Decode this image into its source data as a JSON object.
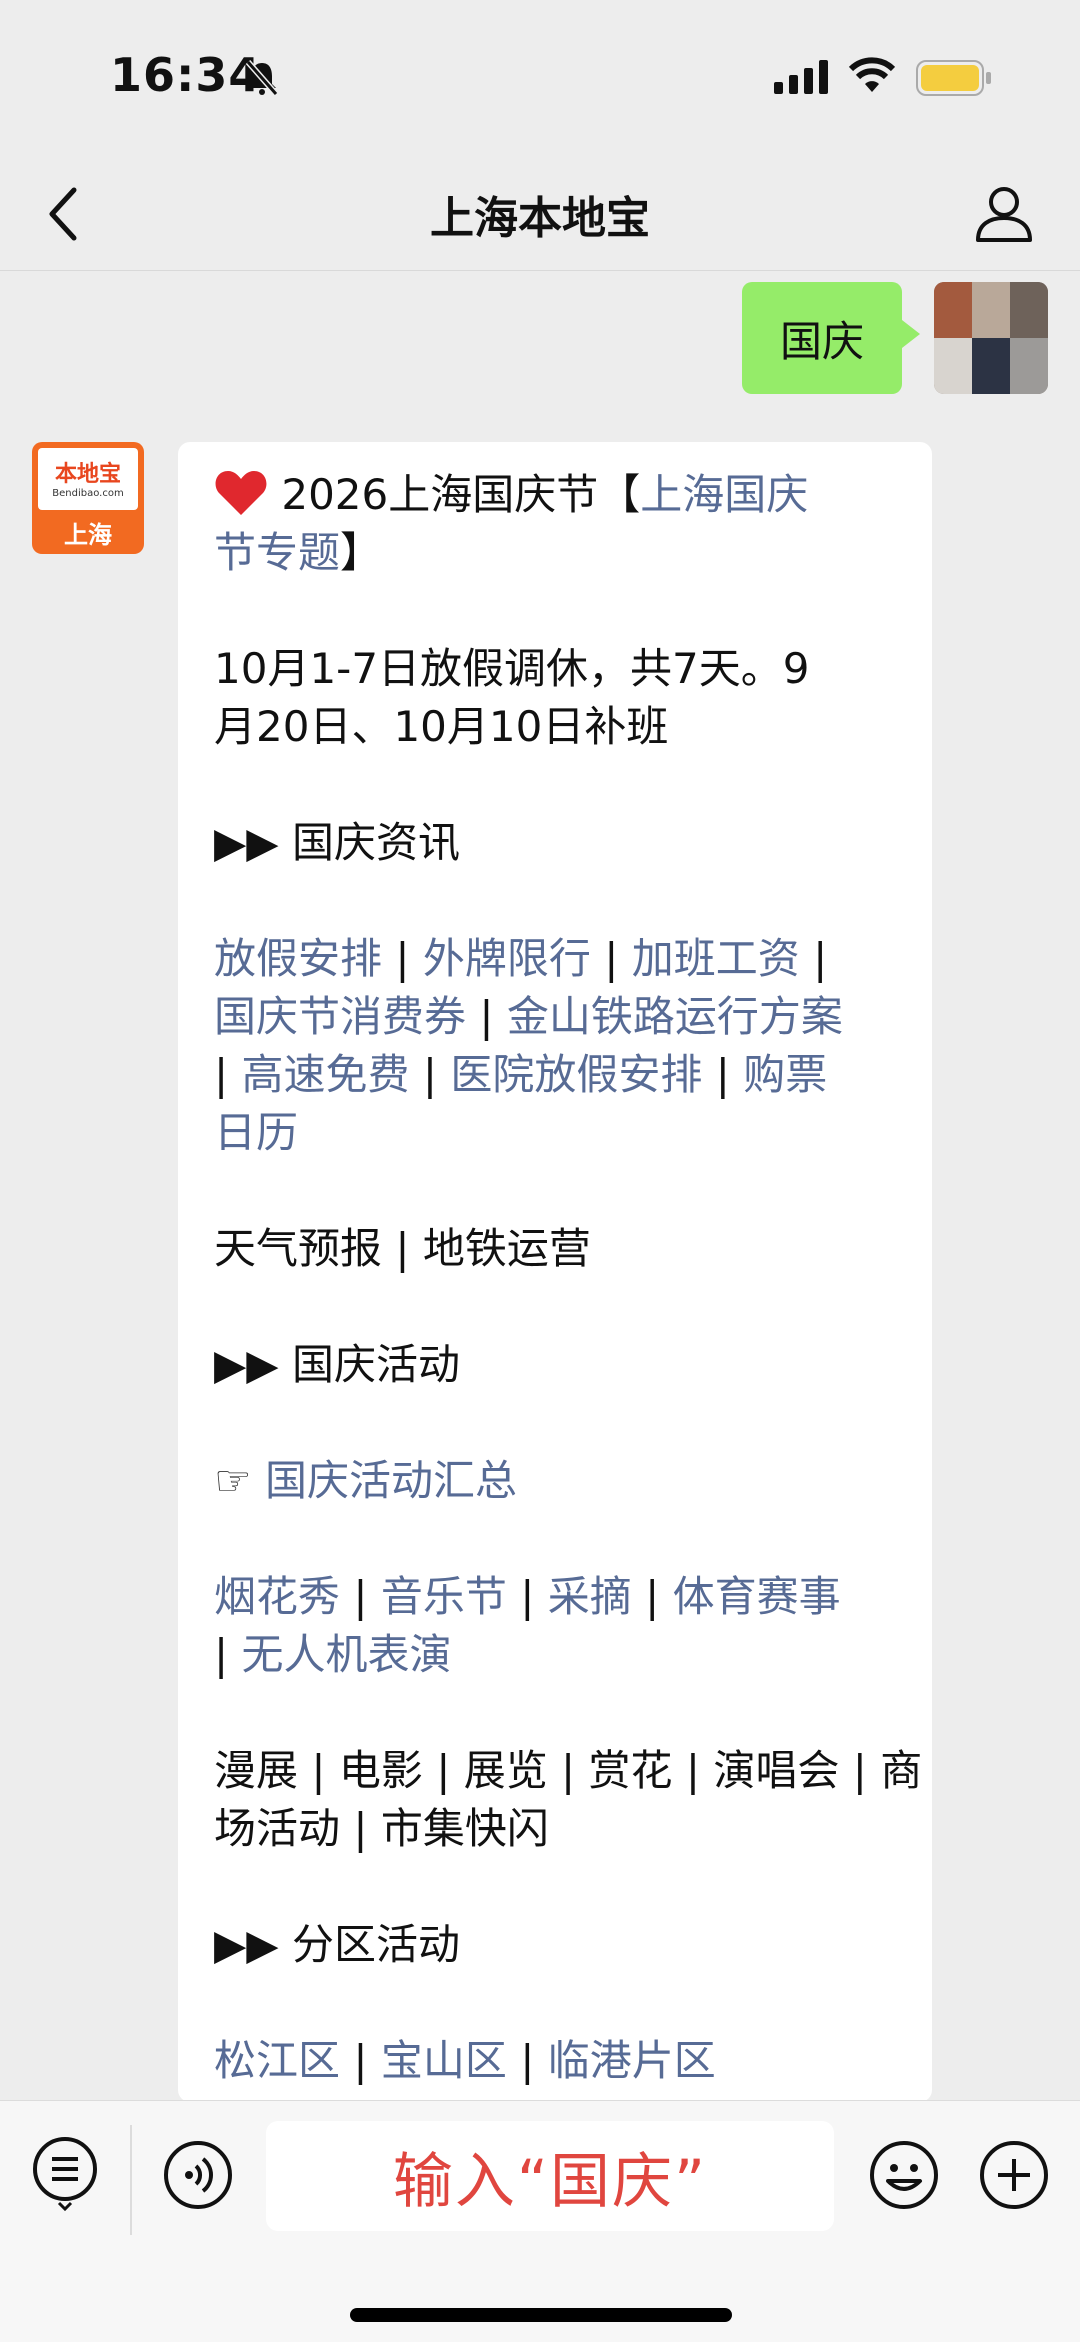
{
  "status_bar": {
    "time": "16:34"
  },
  "nav": {
    "title": "上海本地宝"
  },
  "outgoing": {
    "text": "国庆"
  },
  "bot_avatar": {
    "logo": "本地宝",
    "sub": "Bendibao.com",
    "city": "上海"
  },
  "card": {
    "title_prefix": "2026上海国庆节【",
    "title_link_1": "上海国庆",
    "title_link_2": "节专题",
    "title_suffix": "】",
    "holiday_1": "10月1-7日放假调休，共7天。9",
    "holiday_2": "月20日、10月10日补班",
    "sec1": "国庆资讯",
    "info_links": [
      "放假安排",
      "外牌限行",
      "加班工资",
      "国庆节消费券",
      "金山铁路运行方案",
      "高速免费",
      "医院放假安排",
      "购票",
      "日历"
    ],
    "weather_line": "天气预报 | 地铁运营",
    "sec2": "国庆活动",
    "summary_link": "国庆活动汇总",
    "act_links": [
      "烟花秀",
      "音乐节",
      "采摘",
      "体育赛事",
      "无人机表演"
    ],
    "plain_1": "漫展 | 电影 | 展览 | 赏花 | 演唱会 | 商",
    "plain_2": "场活动 | 市集快闪",
    "sec3": "分区活动",
    "district_links": [
      "松江区",
      "宝山区",
      "临港片区"
    ]
  },
  "input": {
    "text": "输入“国庆”"
  },
  "colors": {
    "bubble_out": "#95ec69",
    "link": "#576b95",
    "accent": "#f26a21"
  }
}
